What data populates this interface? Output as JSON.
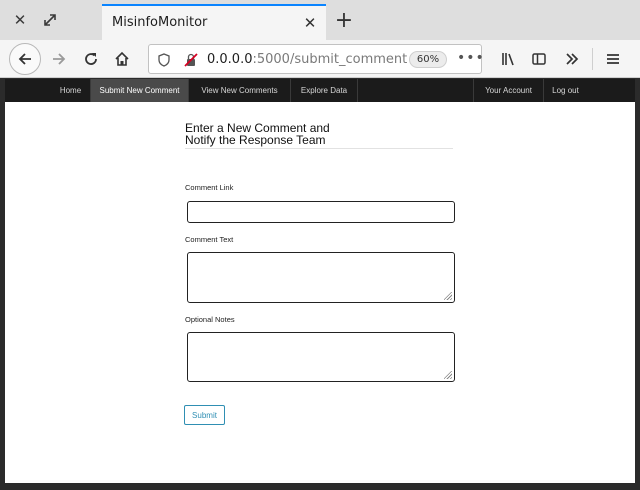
{
  "browser": {
    "tab_title": "MisinfoMonitor",
    "url_host": "0.0.0.0",
    "url_path": ":5000/submit_comment",
    "zoom": "60%",
    "icons": {
      "close_window": "close-icon",
      "restore": "resize-icon",
      "back": "arrow-left-icon",
      "forward": "arrow-right-icon",
      "reload": "reload-icon",
      "home": "home-icon",
      "shield": "shield-icon",
      "insecure": "insecure-lock-icon",
      "library": "library-icon",
      "sidebar": "sidebar-icon",
      "overflow": "chevron-double-right-icon",
      "menu": "hamburger-menu-icon"
    }
  },
  "site_nav": {
    "items": [
      {
        "label": "Home"
      },
      {
        "label": "Submit New Comment"
      },
      {
        "label": "View New Comments"
      },
      {
        "label": "Explore Data"
      }
    ],
    "right_items": [
      {
        "label": "Your Account"
      },
      {
        "label": "Log out"
      }
    ],
    "active_index": 1
  },
  "form": {
    "heading_line1": "Enter a New Comment and",
    "heading_line2": "Notify the Response Team",
    "fields": [
      {
        "label": "Comment Link",
        "value": ""
      },
      {
        "label": "Comment Text",
        "value": ""
      },
      {
        "label": "Optional Notes",
        "value": ""
      }
    ],
    "submit_label": "Submit"
  },
  "colors": {
    "accent_tab": "#0a84ff",
    "nav_bg": "#1b1b1b",
    "nav_active_bg": "#4a4a4a",
    "submit_color": "#2f8fb3"
  }
}
